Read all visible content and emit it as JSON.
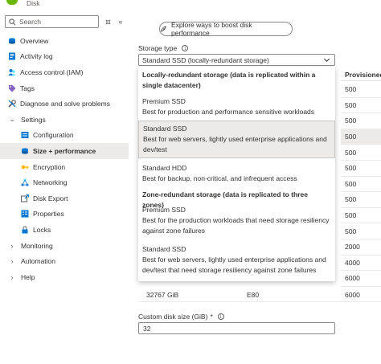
{
  "header": {
    "subtitle": "Disk"
  },
  "sidebar": {
    "search_placeholder": "Search",
    "items": [
      {
        "label": "Overview",
        "icon": "overview-icon"
      },
      {
        "label": "Activity log",
        "icon": "activity-log-icon"
      },
      {
        "label": "Access control (IAM)",
        "icon": "iam-icon"
      },
      {
        "label": "Tags",
        "icon": "tag-icon"
      },
      {
        "label": "Diagnose and solve problems",
        "icon": "wrench-icon"
      },
      {
        "label": "Settings",
        "icon": "chevron-down-icon"
      },
      {
        "label": "Configuration",
        "icon": "configuration-icon"
      },
      {
        "label": "Size + performance",
        "icon": "size-performance-icon"
      },
      {
        "label": "Encryption",
        "icon": "key-icon"
      },
      {
        "label": "Networking",
        "icon": "networking-icon"
      },
      {
        "label": "Disk Export",
        "icon": "disk-export-icon"
      },
      {
        "label": "Properties",
        "icon": "properties-icon"
      },
      {
        "label": "Locks",
        "icon": "lock-icon"
      },
      {
        "label": "Monitoring",
        "icon": "chevron-right-icon"
      },
      {
        "label": "Automation",
        "icon": "chevron-right-icon"
      },
      {
        "label": "Help",
        "icon": "chevron-right-icon"
      }
    ]
  },
  "main": {
    "explore_button": "Explore ways to boost disk performance",
    "storage_type_label": "Storage type",
    "storage_type_value": "Standard SSD (locally-redundant storage)",
    "table": {
      "provisioned_header": "Provisioned",
      "provisioned_values": [
        "500",
        "500",
        "500",
        "500",
        "500",
        "500",
        "500",
        "500",
        "500",
        "500",
        "2000",
        "4000",
        "6000"
      ],
      "last_row": {
        "size": "32767 GiB",
        "tier": "E80",
        "provisioned": "6000"
      }
    },
    "dropdown": {
      "group1": "Locally-redundant storage (data is replicated within a single datacenter)",
      "group2": "Zone-redundant storage (data is replicated to three zones)",
      "options": [
        {
          "title": "Premium SSD",
          "desc": "Best for production and performance sensitive workloads"
        },
        {
          "title": "Standard SSD",
          "desc": "Best for web servers, lightly used enterprise applications and dev/test"
        },
        {
          "title": "Standard HDD",
          "desc": "Best for backup, non-critical, and infrequent access"
        },
        {
          "title": "Premium SSD",
          "desc": "Best for the production workloads that need storage resiliency against zone failures"
        },
        {
          "title": "Standard SSD",
          "desc": "Best for web servers, lightly used enterprise applications and dev/test that need storage resiliency against zone failures"
        }
      ]
    },
    "custom_size_label": "Custom disk size (GiB)",
    "custom_size_required": "*",
    "custom_size_value": "32"
  },
  "colors": {
    "accent": "#0078d4",
    "selected_bg": "#edebe9",
    "border": "#8a8886"
  }
}
